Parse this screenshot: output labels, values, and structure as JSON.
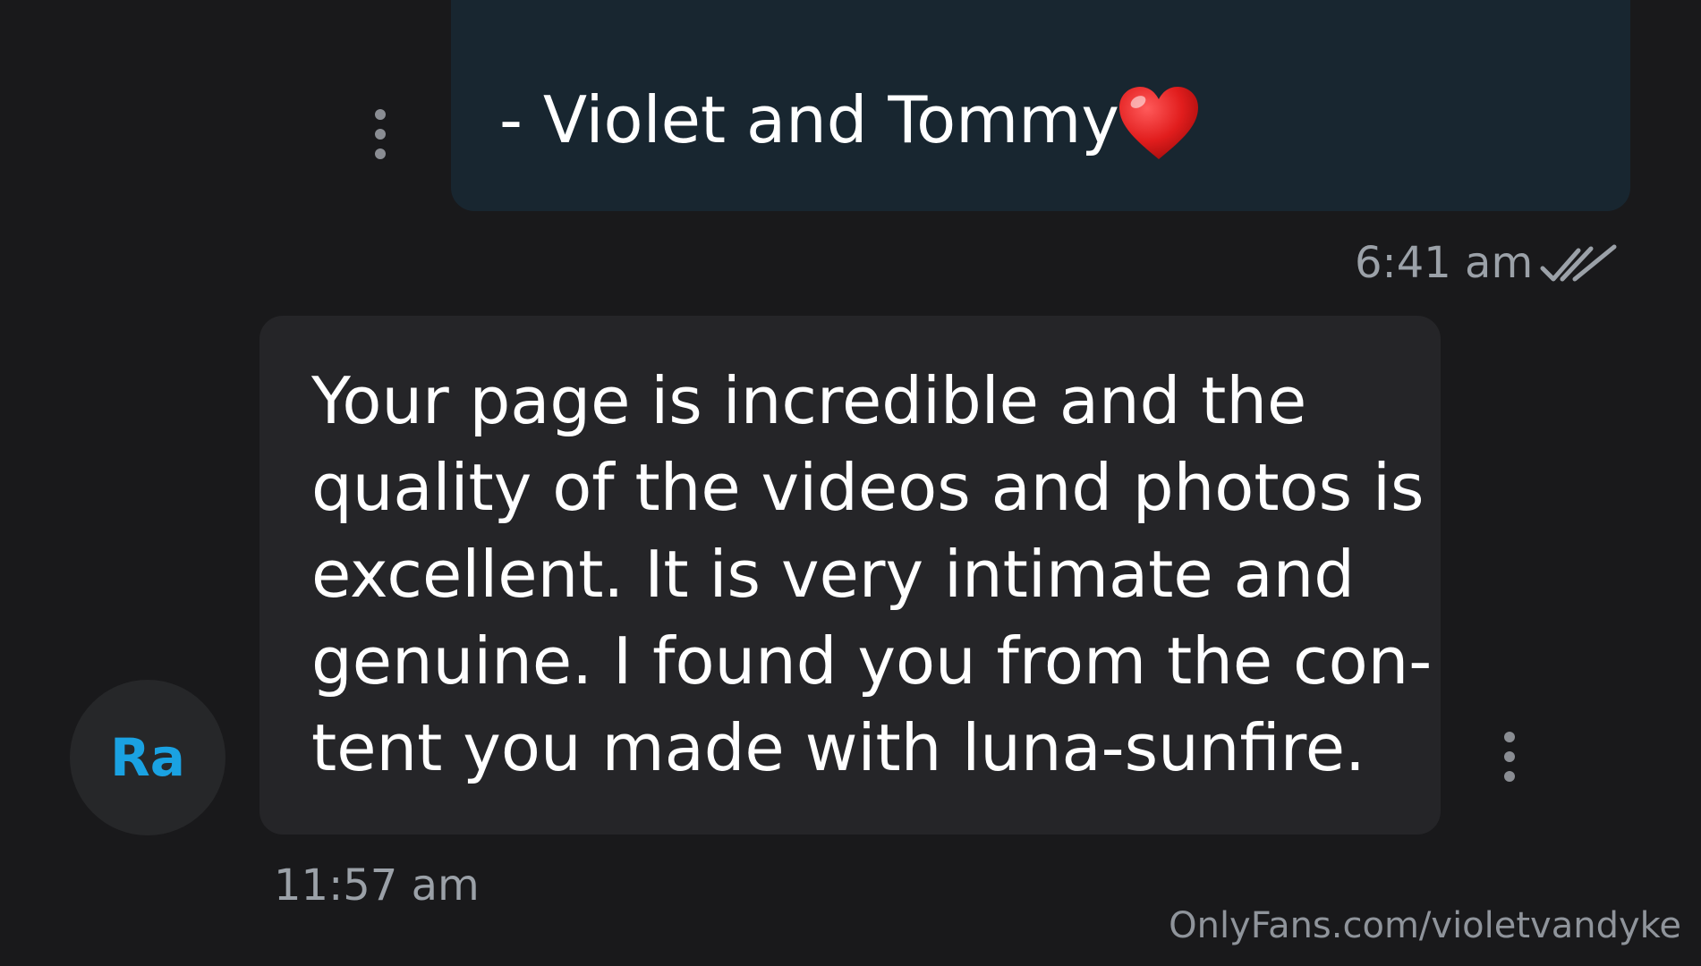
{
  "sent_message": {
    "text": "- Violet and Tommy",
    "emoji": "heart-icon",
    "time": "6:41 am",
    "status_icon": "double-check-icon"
  },
  "received_message": {
    "lines": [
      "Your page is incredible and the",
      "quality of the videos and photos is",
      "excellent. It is very intimate and",
      "genuine. I found you from the con-",
      "tent you made with luna-sunfire."
    ],
    "time": "11:57 am",
    "avatar_initials": "Ra"
  },
  "watermark": "OnlyFans.com/violetvandyke",
  "colors": {
    "background": "#19191b",
    "sent_bubble": "#182630",
    "received_bubble": "#252528",
    "avatar_accent": "#1aa2e2",
    "timestamp": "#9ba1a8"
  }
}
